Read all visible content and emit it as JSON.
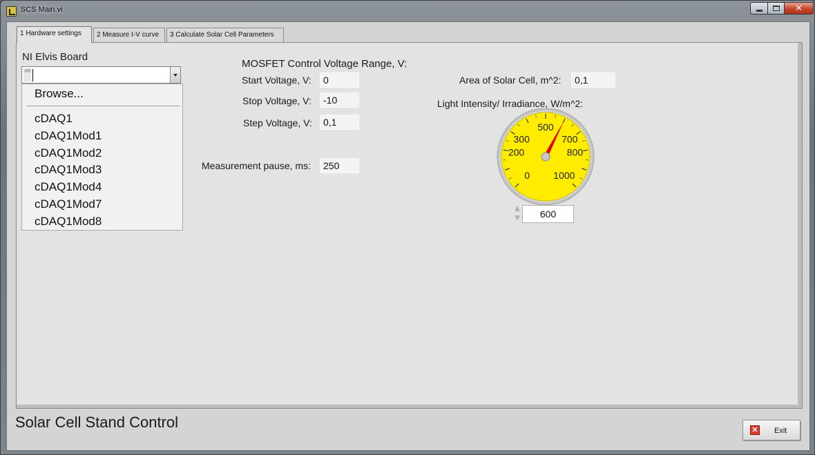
{
  "window": {
    "title": "SCS Main.vi",
    "close_glyph": "✕"
  },
  "tabs": [
    {
      "label": "1 Hardware settings",
      "active": true
    },
    {
      "label": "2 Measure I-V curve",
      "active": false
    },
    {
      "label": "3 Calculate Solar Cell Parameters",
      "active": false
    }
  ],
  "hardware": {
    "board_label": "NI Elvis Board",
    "board_value": "",
    "io_icon_text": "I/O",
    "dropdown": {
      "browse": "Browse...",
      "options": [
        "cDAQ1",
        "cDAQ1Mod1",
        "cDAQ1Mod2",
        "cDAQ1Mod3",
        "cDAQ1Mod4",
        "cDAQ1Mod7",
        "cDAQ1Mod8"
      ]
    }
  },
  "mosfet": {
    "heading": "MOSFET Control Voltage Range, V:",
    "start_label": "Start Voltage, V:",
    "start_value": "0",
    "stop_label": "Stop Voltage, V:",
    "stop_value": "-10",
    "step_label": "Step Voltage, V:",
    "step_value": "0,1"
  },
  "pause": {
    "label": "Measurement pause, ms:",
    "value": "250"
  },
  "solar": {
    "area_label": "Area of Solar Cell, m^2:",
    "area_value": "0,1",
    "irradiance_label": "Light Intensity/ Irradiance, W/m^2:",
    "irradiance_value": "600"
  },
  "gauge": {
    "min": 0,
    "max": 1000,
    "value": 600,
    "tick_labels": [
      "0",
      "200",
      "300",
      "500",
      "700",
      "800",
      "1000"
    ],
    "face_color": "#ffec00",
    "needle_color": "#e00000"
  },
  "footer": {
    "title": "Solar Cell Stand Control",
    "exit_label": "Exit",
    "exit_icon": "close-icon",
    "exit_glyph": "✕"
  }
}
